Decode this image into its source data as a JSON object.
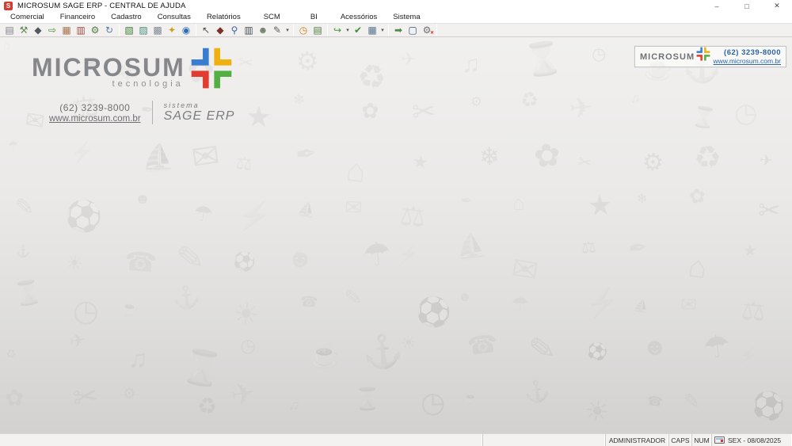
{
  "window": {
    "title": "MICROSUM SAGE ERP - CENTRAL DE AJUDA",
    "app_icon_letter": "S",
    "controls": {
      "minimize": "–",
      "maximize": "□",
      "close": "✕"
    }
  },
  "menubar": {
    "items": [
      {
        "label": "Comercial"
      },
      {
        "label": "Financeiro"
      },
      {
        "label": "Cadastro"
      },
      {
        "label": "Consultas"
      },
      {
        "label": "Relatórios"
      },
      {
        "label": "SCM",
        "wide": true
      },
      {
        "label": "BI",
        "wide": true
      },
      {
        "label": "Acessórios"
      },
      {
        "label": "Sistema"
      }
    ]
  },
  "toolbar": {
    "items": [
      {
        "name": "workstation-icon",
        "glyph": "▤",
        "color": "#7d8288"
      },
      {
        "name": "cart-icon",
        "glyph": "⚒",
        "color": "#5f8a52"
      },
      {
        "name": "money-bag-icon",
        "glyph": "◆",
        "color": "#55585c"
      },
      {
        "name": "delivery-truck-icon",
        "glyph": "⇨",
        "color": "#4d8f45"
      },
      {
        "name": "stock-box-icon",
        "glyph": "▦",
        "color": "#a6714a"
      },
      {
        "name": "archive-cabinet-icon",
        "glyph": "▥",
        "color": "#9b4a3f"
      },
      {
        "name": "equipment-icon",
        "glyph": "⚙",
        "color": "#4f7d43"
      },
      {
        "name": "refresh-document-icon",
        "glyph": "↻",
        "color": "#5a7ba8"
      },
      {
        "sep": true
      },
      {
        "name": "catalog-book-icon",
        "glyph": "▧",
        "color": "#3f7e3a"
      },
      {
        "name": "images-icon",
        "glyph": "▨",
        "color": "#4b8e7c"
      },
      {
        "name": "copy-documents-icon",
        "glyph": "▩",
        "color": "#7f8894"
      },
      {
        "name": "messenger-bird-icon",
        "glyph": "✦",
        "color": "#caa21d"
      },
      {
        "name": "globe-icon",
        "glyph": "◉",
        "color": "#2c6fb4"
      },
      {
        "sep": true
      },
      {
        "name": "pointer-flash-icon",
        "glyph": "↖",
        "color": "#4b4f54"
      },
      {
        "name": "vehicle-icon",
        "glyph": "◆",
        "color": "#7d2f28"
      },
      {
        "name": "search-icon",
        "glyph": "⚲",
        "color": "#3b66a0"
      },
      {
        "name": "columns-report-icon",
        "glyph": "▥",
        "color": "#474b50"
      },
      {
        "name": "users-icon",
        "glyph": "☻",
        "color": "#6f7a68"
      },
      {
        "name": "edit-document-icon",
        "glyph": "✎",
        "color": "#5a5e63",
        "dd": true
      },
      {
        "sep": true
      },
      {
        "name": "clock-icon",
        "glyph": "◷",
        "color": "#d07f1e"
      },
      {
        "name": "library-icon",
        "glyph": "▤",
        "color": "#4d7b3f"
      },
      {
        "sep": true
      },
      {
        "name": "forward-arrow-icon",
        "glyph": "↪",
        "color": "#3f9a3a",
        "dd": true
      },
      {
        "name": "checklist-icon",
        "glyph": "✔",
        "color": "#3f8c39"
      },
      {
        "name": "calculator-icon",
        "glyph": "▦",
        "color": "#56708c",
        "dd": true
      },
      {
        "sep": true
      },
      {
        "name": "export-icon",
        "glyph": "➡",
        "color": "#4f8a44"
      },
      {
        "name": "monitor-icon",
        "glyph": "▢",
        "color": "#35557e"
      },
      {
        "name": "exit-system-icon",
        "glyph": "⚙",
        "color": "#6b6f74",
        "badge": "✕"
      },
      {
        "sep": true
      }
    ]
  },
  "branding": {
    "logo_text": "MICROSUM",
    "logo_sub": "tecnologia",
    "phone": "(62) 3239-8000",
    "website": "www.microsum.com.br",
    "system_label": "sistema",
    "system_name": "SAGE ERP",
    "logo_colors": {
      "blue": "#3a7dd0",
      "yellow": "#efb012",
      "green": "#52b043",
      "red": "#e23b30"
    }
  },
  "header_box": {
    "logo_text": "MICROSUM",
    "phone": "(62) 3239-8000",
    "website": "www.microsum.com.br"
  },
  "statusbar": {
    "user": "ADMINISTRADOR",
    "caps": "CAPS",
    "num": "NUM",
    "date": "SEX - 08/08/2025"
  },
  "watermark": {
    "glyphs": [
      "⌂",
      "✈",
      "☎",
      "✉",
      "✂",
      "☕",
      "☂",
      "★",
      "♫",
      "✎",
      "⚖",
      "⚙",
      "⚓",
      "⚡",
      "❄",
      "⌛",
      "⚽",
      "✒",
      "♻",
      "☀",
      "⛵",
      "✿",
      "◷",
      "☻"
    ]
  }
}
